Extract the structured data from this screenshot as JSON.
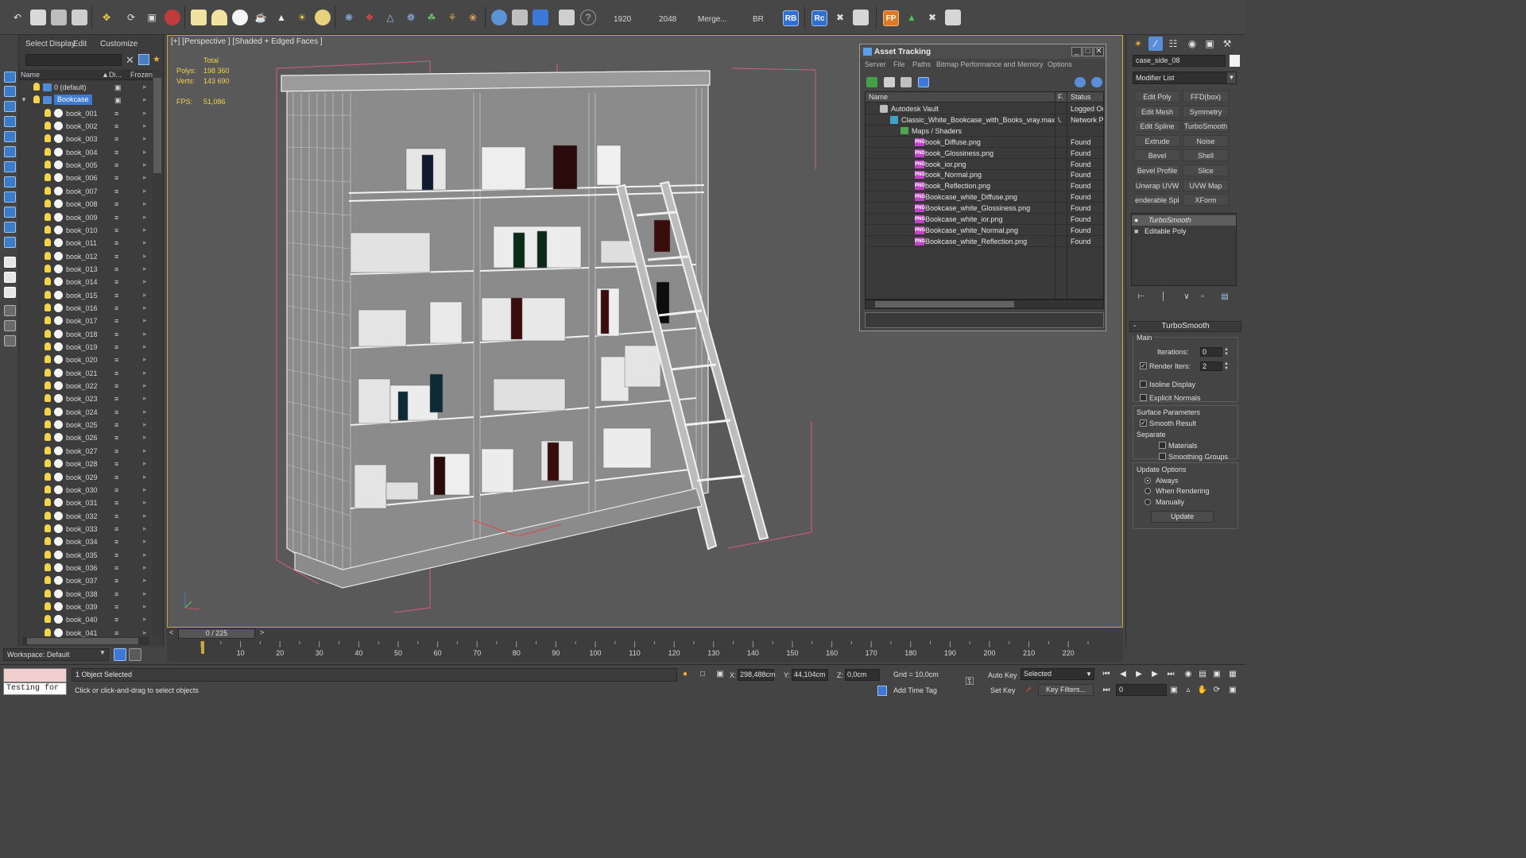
{
  "toolbar": {
    "render_width": "1920",
    "render_height": "2048",
    "merge_label": "Merge...",
    "br_label": "BR",
    "rb_label": "RB",
    "rc_label": "Rc",
    "fp_label": "FP"
  },
  "explorer": {
    "menu": [
      "Select",
      "Display",
      "Edit",
      "Customize"
    ],
    "columns": [
      "Name",
      "Di...",
      "Frozen"
    ],
    "rows": [
      {
        "name": "0 (default)",
        "type": "layer",
        "depth": 0
      },
      {
        "name": "Bookcase",
        "type": "layer",
        "depth": 0,
        "selected": true
      },
      {
        "name": "book_001"
      },
      {
        "name": "book_002"
      },
      {
        "name": "book_003"
      },
      {
        "name": "book_004"
      },
      {
        "name": "book_005"
      },
      {
        "name": "book_006"
      },
      {
        "name": "book_007"
      },
      {
        "name": "book_008"
      },
      {
        "name": "book_009"
      },
      {
        "name": "book_010"
      },
      {
        "name": "book_011"
      },
      {
        "name": "book_012"
      },
      {
        "name": "book_013"
      },
      {
        "name": "book_014"
      },
      {
        "name": "book_015"
      },
      {
        "name": "book_016"
      },
      {
        "name": "book_017"
      },
      {
        "name": "book_018"
      },
      {
        "name": "book_019"
      },
      {
        "name": "book_020"
      },
      {
        "name": "book_021"
      },
      {
        "name": "book_022"
      },
      {
        "name": "book_023"
      },
      {
        "name": "book_024"
      },
      {
        "name": "book_025"
      },
      {
        "name": "book_026"
      },
      {
        "name": "book_027"
      },
      {
        "name": "book_028"
      },
      {
        "name": "book_029"
      },
      {
        "name": "book_030"
      },
      {
        "name": "book_031"
      },
      {
        "name": "book_032"
      },
      {
        "name": "book_033"
      },
      {
        "name": "book_034"
      },
      {
        "name": "book_035"
      },
      {
        "name": "book_036"
      },
      {
        "name": "book_037"
      },
      {
        "name": "book_038"
      },
      {
        "name": "book_039"
      },
      {
        "name": "book_040"
      },
      {
        "name": "book_041"
      }
    ]
  },
  "viewport": {
    "label": "[+] [Perspective ] [Shaded + Edged Faces ]",
    "stats_header": "Total",
    "polys_label": "Polys:",
    "polys_value": "198 360",
    "verts_label": "Verts:",
    "verts_value": "143 690",
    "fps_label": "FPS:",
    "fps_value": "51,086",
    "accent_color": "#c7a93b"
  },
  "asset_tracking": {
    "title": "Asset Tracking",
    "menu": [
      "Server",
      "File",
      "Paths",
      "Bitmap Performance and Memory",
      "Options"
    ],
    "columns": [
      "Name",
      "F.",
      "Status"
    ],
    "rows": [
      {
        "name": "Autodesk Vault",
        "status": "Logged Ou",
        "indent": 0,
        "kind": "vault"
      },
      {
        "name": "Classic_White_Bookcase_with_Books_vray.max",
        "f": "\\.",
        "status": "Network P",
        "indent": 1,
        "kind": "max"
      },
      {
        "name": "Maps / Shaders",
        "status": "",
        "indent": 2,
        "kind": "folder"
      },
      {
        "name": "book_Diffuse.png",
        "status": "Found",
        "indent": 3,
        "kind": "png"
      },
      {
        "name": "book_Glossiness.png",
        "status": "Found",
        "indent": 3,
        "kind": "png"
      },
      {
        "name": "book_ior.png",
        "status": "Found",
        "indent": 3,
        "kind": "png"
      },
      {
        "name": "book_Normal.png",
        "status": "Found",
        "indent": 3,
        "kind": "png"
      },
      {
        "name": "book_Reflection.png",
        "status": "Found",
        "indent": 3,
        "kind": "png"
      },
      {
        "name": "Bookcase_white_Diffuse.png",
        "status": "Found",
        "indent": 3,
        "kind": "png"
      },
      {
        "name": "Bookcase_white_Glossiness.png",
        "status": "Found",
        "indent": 3,
        "kind": "png"
      },
      {
        "name": "Bookcase_white_ior.png",
        "status": "Found",
        "indent": 3,
        "kind": "png"
      },
      {
        "name": "Bookcase_white_Normal.png",
        "status": "Found",
        "indent": 3,
        "kind": "png"
      },
      {
        "name": "Bookcase_white_Reflection.png",
        "status": "Found",
        "indent": 3,
        "kind": "png"
      }
    ],
    "png_badge": "PNG"
  },
  "command_panel": {
    "object_name": "case_side_08",
    "modifier_list": "Modifier List",
    "modifier_buttons": [
      [
        "Edit Poly",
        "FFD(box)"
      ],
      [
        "Edit Mesh",
        "Symmetry"
      ],
      [
        "Edit Spline",
        "TurboSmooth"
      ],
      [
        "Extrude",
        "Noise"
      ],
      [
        "Bevel",
        "Shell"
      ],
      [
        "Bevel Profile",
        "Slice"
      ],
      [
        "Unwrap UVW",
        "UVW Map"
      ],
      [
        "enderable Splin",
        "XForm"
      ]
    ],
    "stack": [
      "TurboSmooth",
      "Editable Poly"
    ],
    "turbosmooth": {
      "title": "TurboSmooth",
      "main_label": "Main",
      "iterations_label": "Iterations:",
      "iterations_value": "0",
      "render_iters_label": "Render Iters:",
      "render_iters_value": "2",
      "render_iters_checked": true,
      "isoline_label": "Isoline Display",
      "explicit_normals_label": "Explicit Normals",
      "surface_params_label": "Surface Parameters",
      "smooth_result_label": "Smooth Result",
      "smooth_result_checked": true,
      "separate_label": "Separate",
      "materials_label": "Materials",
      "smoothing_groups_label": "Smoothing Groups",
      "update_options_label": "Update Options",
      "always_label": "Always",
      "when_rendering_label": "When Rendering",
      "manually_label": "Manually",
      "update_option_selected": "Always",
      "update_button": "Update"
    }
  },
  "timeline": {
    "frame_display": "0 / 225",
    "ticks": [
      "10",
      "20",
      "30",
      "40",
      "50",
      "60",
      "70",
      "80",
      "90",
      "100",
      "110",
      "120",
      "130",
      "140",
      "150",
      "160",
      "170",
      "180",
      "190",
      "200",
      "210",
      "220"
    ],
    "workspace": "Workspace: Default"
  },
  "status": {
    "maxscript_text": "Testing for",
    "selection": "1 Object Selected",
    "prompt": "Click or click-and-drag to select objects",
    "x_label": "X:",
    "x_value": "298,488cm",
    "y_label": "Y:",
    "y_value": "44,104cm",
    "z_label": "Z:",
    "z_value": "0,0cm",
    "grid": "Grid = 10,0cm",
    "add_time_tag": "Add Time Tag",
    "auto_key": "Auto Key",
    "set_key": "Set Key",
    "selected_dropdown": "Selected",
    "key_filters": "Key Filters...",
    "frame_value": "0"
  }
}
